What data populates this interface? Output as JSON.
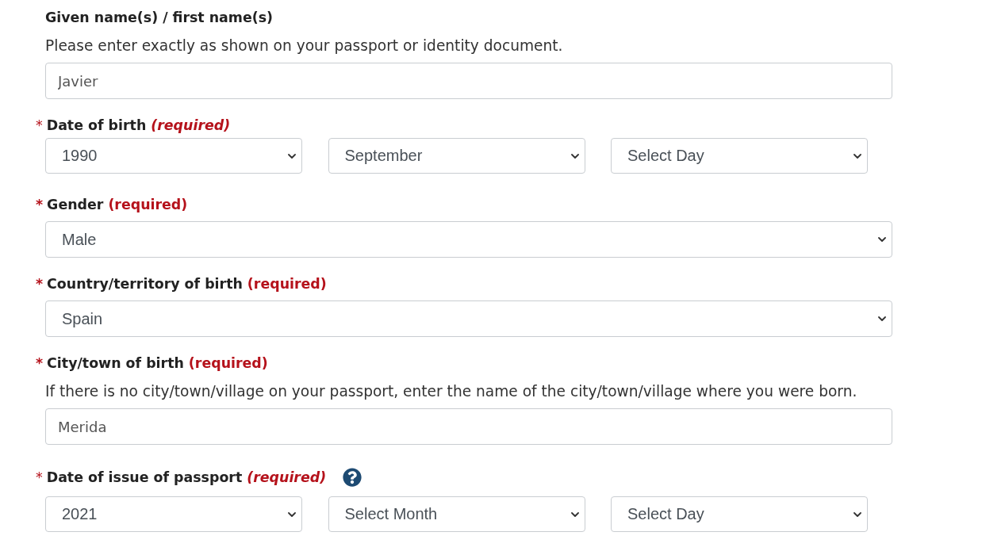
{
  "form": {
    "fields": [
      {
        "kind": "text",
        "label": "Given name(s) / first name(s)",
        "hint": "Please enter exactly as shown on your passport or identity document.",
        "value": "Javier",
        "help": false
      },
      {
        "kind": "date",
        "marker": "*",
        "label": "Date of birth",
        "required": "(required)",
        "required_italic": true,
        "help": false,
        "selects": [
          "1990",
          "September",
          "Select Day"
        ]
      },
      {
        "kind": "select",
        "marker": "*",
        "label": "Gender",
        "required": "(required)",
        "required_italic": false,
        "help": false,
        "value": "Male"
      },
      {
        "kind": "select",
        "marker": "*",
        "label": "Country/territory of birth",
        "required": "(required)",
        "required_italic": false,
        "help": false,
        "value": "Spain"
      },
      {
        "kind": "text",
        "marker": "*",
        "label": "City/town of birth",
        "required": "(required)",
        "required_italic": false,
        "hint": "If there is no city/town/village on your passport, enter the name of the city/town/village where you were born.",
        "value": "Merida",
        "help": false
      },
      {
        "kind": "date",
        "marker": "*",
        "label": "Date of issue of passport",
        "required": "(required)",
        "required_italic": true,
        "help": true,
        "selects": [
          "2021",
          "Select Month",
          "Select Day"
        ]
      }
    ]
  }
}
